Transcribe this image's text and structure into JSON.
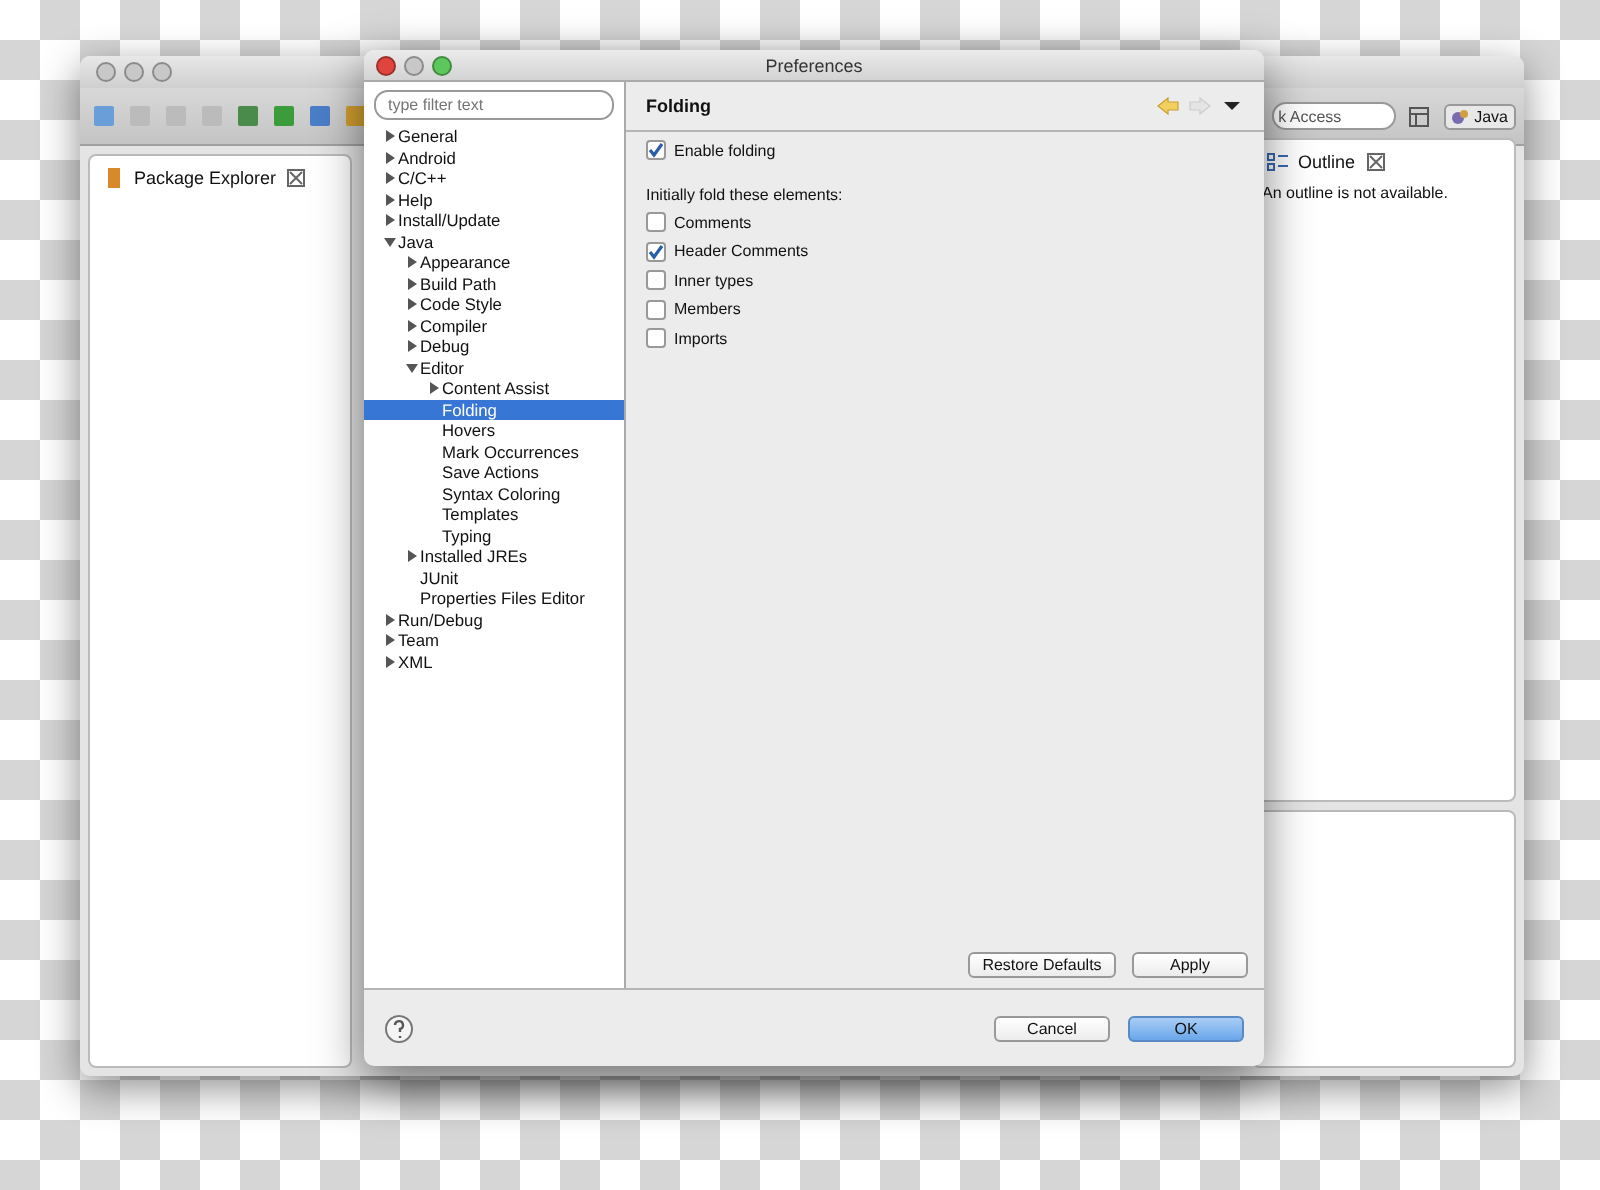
{
  "workbench": {
    "package_explorer": {
      "title": "Package Explorer"
    },
    "quick_access": {
      "text": "k Access"
    },
    "perspective": {
      "label": "Java"
    },
    "outline": {
      "title": "Outline",
      "message": "An outline is not available."
    }
  },
  "dialog": {
    "title": "Preferences",
    "filter": {
      "placeholder": "type filter text"
    },
    "tree": [
      {
        "label": "General",
        "expanded": false,
        "selected": false
      },
      {
        "label": "Android",
        "expanded": false,
        "selected": false
      },
      {
        "label": "C/C++",
        "expanded": false,
        "selected": false
      },
      {
        "label": "Help",
        "expanded": false,
        "selected": false
      },
      {
        "label": "Install/Update",
        "expanded": false,
        "selected": false
      },
      {
        "label": "Java",
        "expanded": true,
        "selected": false,
        "children": [
          {
            "label": "Appearance",
            "expanded": false,
            "selected": false
          },
          {
            "label": "Build Path",
            "expanded": false,
            "selected": false
          },
          {
            "label": "Code Style",
            "expanded": false,
            "selected": false
          },
          {
            "label": "Compiler",
            "expanded": false,
            "selected": false
          },
          {
            "label": "Debug",
            "expanded": false,
            "selected": false
          },
          {
            "label": "Editor",
            "expanded": true,
            "selected": false,
            "children": [
              {
                "label": "Content Assist",
                "expanded": false,
                "selected": false
              },
              {
                "label": "Folding",
                "selected": true
              },
              {
                "label": "Hovers",
                "selected": false
              },
              {
                "label": "Mark Occurrences",
                "selected": false
              },
              {
                "label": "Save Actions",
                "selected": false
              },
              {
                "label": "Syntax Coloring",
                "selected": false
              },
              {
                "label": "Templates",
                "selected": false
              },
              {
                "label": "Typing",
                "selected": false
              }
            ]
          },
          {
            "label": "Installed JREs",
            "expanded": false,
            "selected": false
          },
          {
            "label": "JUnit",
            "selected": false
          },
          {
            "label": "Properties Files Editor",
            "selected": false
          }
        ]
      },
      {
        "label": "Run/Debug",
        "expanded": false,
        "selected": false
      },
      {
        "label": "Team",
        "expanded": false,
        "selected": false
      },
      {
        "label": "XML",
        "expanded": false,
        "selected": false
      }
    ],
    "page": {
      "title": "Folding",
      "enable": {
        "label": "Enable folding",
        "checked": true
      },
      "group_label": "Initially fold these elements:",
      "options": [
        {
          "label": "Comments",
          "checked": false
        },
        {
          "label": "Header Comments",
          "checked": true
        },
        {
          "label": "Inner types",
          "checked": false
        },
        {
          "label": "Members",
          "checked": false
        },
        {
          "label": "Imports",
          "checked": false
        }
      ],
      "page_buttons": [
        "Restore Defaults",
        "Apply"
      ]
    },
    "buttons": [
      {
        "label": "Cancel",
        "default": false
      },
      {
        "label": "OK",
        "default": true
      }
    ]
  }
}
